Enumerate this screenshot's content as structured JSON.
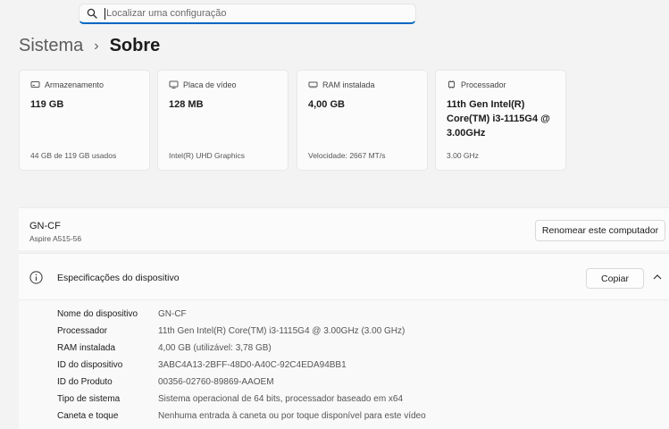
{
  "search": {
    "placeholder": "Localizar uma configuração"
  },
  "breadcrumb": {
    "parent": "Sistema",
    "separator": "›",
    "current": "Sobre"
  },
  "cards": [
    {
      "icon": "storage-icon",
      "title": "Armazenamento",
      "value": "119 GB",
      "footer": "44 GB de 119 GB usados"
    },
    {
      "icon": "gpu-icon",
      "title": "Placa de vídeo",
      "value": "128 MB",
      "footer": "Intel(R) UHD Graphics"
    },
    {
      "icon": "ram-icon",
      "title": "RAM instalada",
      "value": "4,00 GB",
      "footer": "Velocidade: 2667 MT/s"
    },
    {
      "icon": "processor-icon",
      "title": "Processador",
      "value": "11th Gen Intel(R) Core(TM) i3-1115G4 @ 3.00GHz",
      "footer": "3.00 GHz"
    }
  ],
  "device": {
    "name": "GN-CF",
    "model": "Aspire A515-56",
    "rename_label": "Renomear este computador"
  },
  "specs": {
    "title": "Especificações do dispositivo",
    "copy_label": "Copiar",
    "rows": [
      {
        "label": "Nome do dispositivo",
        "value": "GN-CF"
      },
      {
        "label": "Processador",
        "value": "11th Gen Intel(R) Core(TM) i3-1115G4 @ 3.00GHz (3.00 GHz)"
      },
      {
        "label": "RAM instalada",
        "value": "4,00 GB (utilizável: 3,78 GB)"
      },
      {
        "label": "ID do dispositivo",
        "value": "3ABC4A13-2BFF-48D0-A40C-92C4EDA94BB1"
      },
      {
        "label": "ID do Produto",
        "value": "00356-02760-89869-AAOEM"
      },
      {
        "label": "Tipo de sistema",
        "value": "Sistema operacional de 64 bits, processador baseado em x64"
      },
      {
        "label": "Caneta e toque",
        "value": "Nenhuma entrada à caneta ou por toque disponível para este vídeo"
      }
    ]
  },
  "colors": {
    "accent": "#0067c0",
    "background": "#f3f3f3",
    "card": "#fbfbfb"
  }
}
